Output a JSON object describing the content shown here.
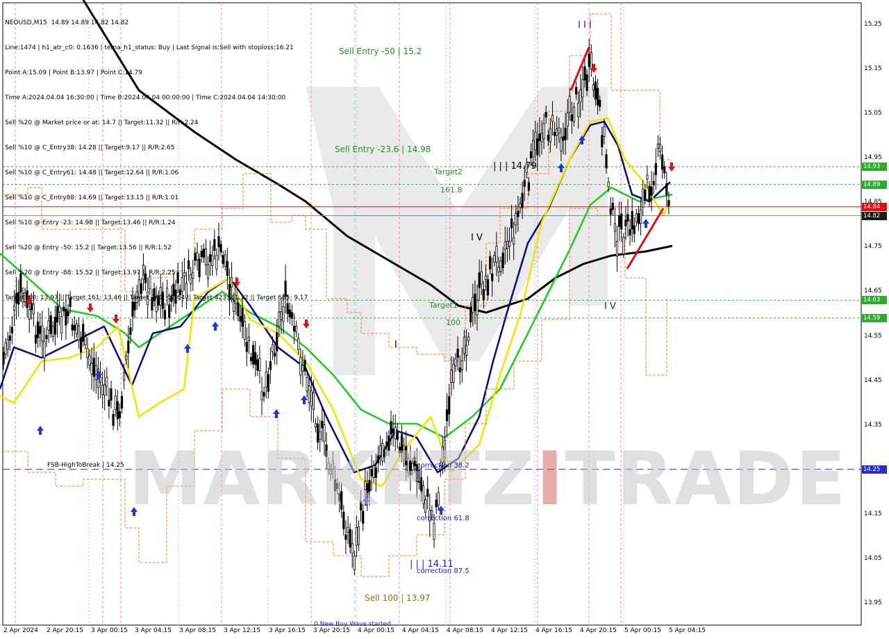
{
  "header": {
    "lines": [
      "NEOUSD,M15  14.89 14.89 14.82 14.82",
      "Line:1474 | h1_atr_c0: 0.1636 | tema_h1_status: Buy | Last Signal is:Sell with stoploss:16.21",
      "Point A:15.09 | Point B:13.97 | Point C:14.79",
      "Time A:2024.04.04 16:30:00 | Time B:2024.04.04 00:00:00 | Time C:2024.04.04 14:30:00",
      "Sell %20 @ Market price or at: 14.7 || Target:11.32 || R/R:2.24",
      "Sell %10 @ C_Entry38: 14.28 || Target:9.17 || R/R:2.65",
      "Sell %10 @ C_Entry61: 14.48 || Target:12.64 || R/R:1.06",
      "Sell %10 @ C_Entry88: 14.69 || Target:13.15 || R/R:1.01",
      "Sell %10 @ Entry -23: 14.98 || Target:13.46 || R/R:1.24",
      "Sell %20 @ Entry -50: 15.2 || Target:13.56 || R/R:1.52",
      "Sell %20 @ Entry -88: 15.52 || Target:13.97 || R/R:2.25",
      "Target100: 13.97 || Target 161: 13.46 || Target 261: 12.64 || Target 423: 11.32 || Target 685: 9.17"
    ]
  },
  "watermark": {
    "left": "MARKETZ",
    "accent": "I",
    "right": "TRADE"
  },
  "annotations": {
    "sell_entry_50": "Sell Entry -50 | 15.2",
    "sell_entry_236": "Sell Entry -23.6 | 14.98",
    "target2": "Target2",
    "t1618": "161.8",
    "wave_c_top": "| | | 14.79",
    "wave_iv_a": "I V",
    "target1": "Target1",
    "t100": "100",
    "wave_i": "I",
    "wave_iii_top": "I I I",
    "wave_iv_b": "I V",
    "fsb": "FSB-HighToBreak | 14.25",
    "corr382": "correction 38.2",
    "corr618": "correction 61.8",
    "corr875": "correction 87.5",
    "wave_low": "| | | 14.11",
    "sell100": "Sell 100 | 13.97",
    "new_wave": "0 New Buy Wave started"
  },
  "chart_data": {
    "type": "line",
    "symbol": "NEOUSD,M15",
    "ylim": [
      13.91,
      15.3
    ],
    "yticks": [
      "15.25",
      "15.15",
      "15.05",
      "14.95",
      "14.85",
      "14.75",
      "14.65",
      "14.55",
      "14.45",
      "14.35",
      "14.25",
      "14.15",
      "14.05",
      "13.95"
    ],
    "xticks": [
      "2 Apr 2024",
      "2 Apr 20:15",
      "3 Apr 00:15",
      "3 Apr 04:15",
      "3 Apr 08:15",
      "3 Apr 12:15",
      "3 Apr 16:15",
      "3 Apr 20:15",
      "4 Apr 00:15",
      "4 Apr 04:15",
      "4 Apr 08:15",
      "4 Apr 12:15",
      "4 Apr 16:15",
      "4 Apr 20:15",
      "5 Apr 00:15",
      "5 Apr 04:15"
    ],
    "price_labels": [
      {
        "text": "14.93",
        "value": 14.93,
        "color": "#2eaa2e"
      },
      {
        "text": "14.89",
        "value": 14.89,
        "color": "#2eaa2e"
      },
      {
        "text": "14.84",
        "value": 14.84,
        "color": "#e01010"
      },
      {
        "text": "14.82",
        "value": 14.82,
        "color": "#1a1a1a"
      },
      {
        "text": "14.63",
        "value": 14.63,
        "color": "#2eaa2e"
      },
      {
        "text": "14.59",
        "value": 14.59,
        "color": "#2eaa2e"
      },
      {
        "text": "14.25",
        "value": 14.25,
        "color": "#2a2ad0"
      }
    ],
    "series": [
      {
        "name": "EMA black",
        "color": "#000000",
        "points": [
          [
            120,
            0
          ],
          [
            200,
            130
          ],
          [
            280,
            190
          ],
          [
            340,
            230
          ],
          [
            400,
            265
          ],
          [
            440,
            290
          ],
          [
            500,
            340
          ],
          [
            560,
            375
          ],
          [
            620,
            410
          ],
          [
            660,
            440
          ],
          [
            700,
            450
          ],
          [
            760,
            430
          ],
          [
            800,
            400
          ],
          [
            840,
            380
          ],
          [
            880,
            368
          ],
          [
            930,
            362
          ],
          [
            968,
            354
          ]
        ]
      },
      {
        "name": "EMA green",
        "color": "#22cc22",
        "points": [
          [
            0,
            365
          ],
          [
            40,
            400
          ],
          [
            90,
            445
          ],
          [
            140,
            455
          ],
          [
            180,
            480
          ],
          [
            200,
            500
          ],
          [
            260,
            460
          ],
          [
            320,
            420
          ],
          [
            360,
            450
          ],
          [
            400,
            470
          ],
          [
            440,
            500
          ],
          [
            480,
            540
          ],
          [
            520,
            590
          ],
          [
            560,
            610
          ],
          [
            600,
            610
          ],
          [
            640,
            630
          ],
          [
            680,
            600
          ],
          [
            720,
            560
          ],
          [
            760,
            480
          ],
          [
            790,
            420
          ],
          [
            820,
            360
          ],
          [
            850,
            295
          ],
          [
            880,
            270
          ],
          [
            920,
            290
          ],
          [
            968,
            280
          ]
        ]
      },
      {
        "name": "TEMA navy",
        "color": "#10107a",
        "points": [
          [
            0,
            560
          ],
          [
            20,
            500
          ],
          [
            60,
            515
          ],
          [
            100,
            495
          ],
          [
            150,
            470
          ],
          [
            190,
            555
          ],
          [
            220,
            480
          ],
          [
            260,
            470
          ],
          [
            300,
            420
          ],
          [
            330,
            400
          ],
          [
            360,
            440
          ],
          [
            400,
            500
          ],
          [
            440,
            530
          ],
          [
            470,
            600
          ],
          [
            510,
            680
          ],
          [
            540,
            670
          ],
          [
            570,
            620
          ],
          [
            600,
            630
          ],
          [
            630,
            680
          ],
          [
            660,
            660
          ],
          [
            690,
            600
          ],
          [
            710,
            520
          ],
          [
            730,
            450
          ],
          [
            760,
            350
          ],
          [
            790,
            300
          ],
          [
            820,
            230
          ],
          [
            850,
            180
          ],
          [
            870,
            175
          ],
          [
            890,
            210
          ],
          [
            910,
            280
          ],
          [
            935,
            290
          ],
          [
            965,
            262
          ]
        ]
      },
      {
        "name": "TEMA yellow",
        "color": "#f2e600",
        "points": [
          [
            0,
            570
          ],
          [
            20,
            580
          ],
          [
            60,
            520
          ],
          [
            100,
            515
          ],
          [
            140,
            500
          ],
          [
            170,
            470
          ],
          [
            200,
            600
          ],
          [
            230,
            580
          ],
          [
            265,
            560
          ],
          [
            280,
            430
          ],
          [
            330,
            400
          ],
          [
            360,
            460
          ],
          [
            400,
            480
          ],
          [
            440,
            520
          ],
          [
            480,
            590
          ],
          [
            520,
            690
          ],
          [
            550,
            700
          ],
          [
            580,
            650
          ],
          [
            620,
            600
          ],
          [
            650,
            680
          ],
          [
            690,
            640
          ],
          [
            720,
            540
          ],
          [
            750,
            450
          ],
          [
            780,
            320
          ],
          [
            820,
            230
          ],
          [
            850,
            175
          ],
          [
            875,
            170
          ],
          [
            900,
            230
          ],
          [
            925,
            260
          ],
          [
            955,
            310
          ],
          [
            965,
            290
          ]
        ]
      }
    ]
  }
}
